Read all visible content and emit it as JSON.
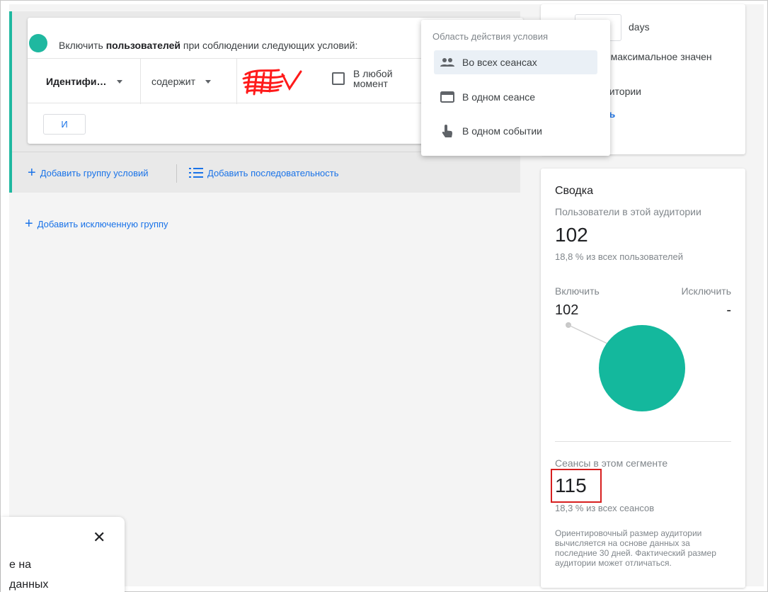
{
  "include": {
    "prefix": "Включить ",
    "bold": "пользователей",
    "suffix": " при соблюдении следующих условий:"
  },
  "condition": {
    "dimension": "Идентифи…",
    "operator": "содержит",
    "anytime_label": "В любой момент",
    "and_button": "И"
  },
  "actions": {
    "add_group": "Добавить группу условий",
    "add_sequence": "Добавить последовательность",
    "add_exclusion": "Добавить исключенную группу"
  },
  "scope_dropdown": {
    "title": "Область действия условия",
    "items": [
      {
        "label": "Во всех сеансах",
        "icon": "people-icon",
        "selected": true
      },
      {
        "label": "В одном сеансе",
        "icon": "window-icon",
        "selected": false
      },
      {
        "label": "В одном событии",
        "icon": "touch-icon",
        "selected": false
      }
    ]
  },
  "membership_panel": {
    "days_unit": "days",
    "max_value_text": "овить максимальное значен",
    "audience_text": "удитории",
    "link_text": "ать"
  },
  "summary": {
    "title": "Сводка",
    "users_label": "Пользователи в этой аудитории",
    "users_count": "102",
    "users_pct": "18,8 % из всех пользователей",
    "include_label": "Включить",
    "exclude_label": "Исключить",
    "include_value": "102",
    "exclude_value": "-",
    "sessions_label": "Сеансы в этом сегменте",
    "sessions_count": "115",
    "sessions_pct": "18,3 % из всех сеансов",
    "note": "Ориентировочный размер аудитории вычисляется на основе данных за последние 30 дней. Фактический размер аудитории может отличаться."
  },
  "toast": {
    "line1": "е на",
    "line2": "данных"
  },
  "colors": {
    "accent": "#1fb8a0",
    "pie": "#14b89d",
    "link": "#1a73e8",
    "highlight": "#d71f1f"
  }
}
